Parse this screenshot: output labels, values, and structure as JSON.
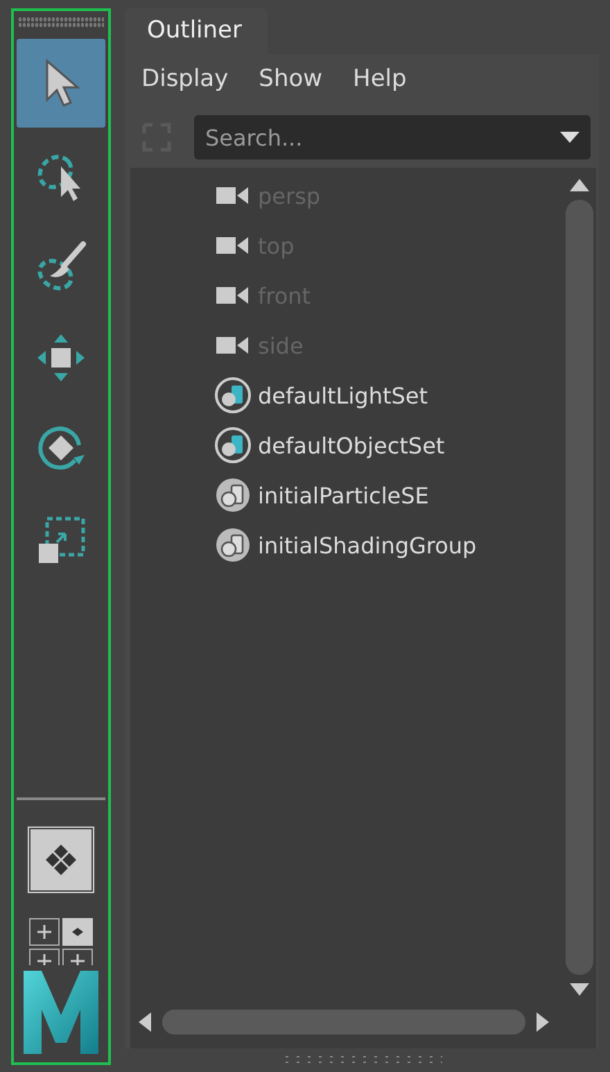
{
  "toolbar": {
    "tools": [
      {
        "kind": "select",
        "selected": true
      },
      {
        "kind": "lasso",
        "selected": false
      },
      {
        "kind": "paint",
        "selected": false
      },
      {
        "kind": "move",
        "selected": false
      },
      {
        "kind": "rotate",
        "selected": false
      },
      {
        "kind": "scale",
        "selected": false
      }
    ]
  },
  "tab": {
    "label": "Outliner",
    "selected": true
  },
  "menu": [
    "Display",
    "Show",
    "Help"
  ],
  "search": {
    "placeholder": "Search..."
  },
  "items": [
    {
      "kind": "camera",
      "label": "persp",
      "dimmed": true
    },
    {
      "kind": "camera",
      "label": "top",
      "dimmed": true
    },
    {
      "kind": "camera",
      "label": "front",
      "dimmed": true
    },
    {
      "kind": "camera",
      "label": "side",
      "dimmed": true
    },
    {
      "kind": "set",
      "label": "defaultLightSet",
      "dimmed": false
    },
    {
      "kind": "set",
      "label": "defaultObjectSet",
      "dimmed": false
    },
    {
      "kind": "shading",
      "label": "initialParticleSE",
      "dimmed": false
    },
    {
      "kind": "shading",
      "label": "initialShadingGroup",
      "dimmed": false
    }
  ]
}
